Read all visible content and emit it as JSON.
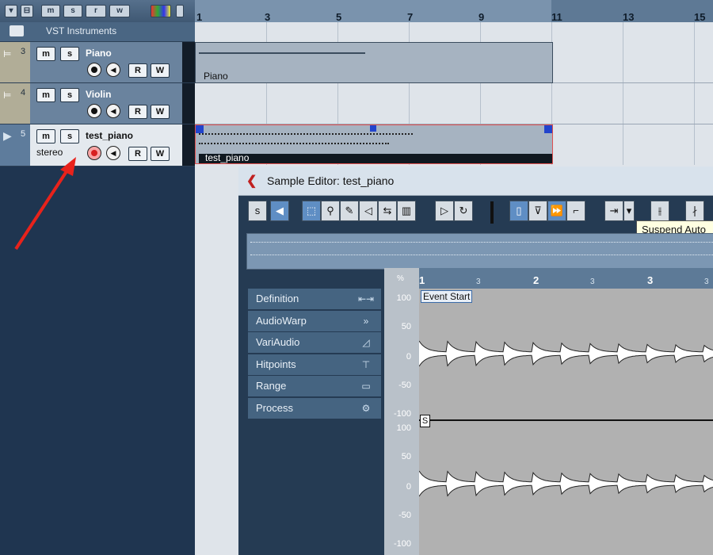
{
  "window": {
    "title": "Sample Editor: test_piano"
  },
  "topbar": {
    "buttons": [
      "m",
      "s",
      "r",
      "w"
    ]
  },
  "folder": {
    "label": "VST Instruments"
  },
  "tracks": [
    {
      "num": "3",
      "name": "Piano",
      "m": "m",
      "s": "s",
      "r": "R",
      "w": "W"
    },
    {
      "num": "4",
      "name": "Violin",
      "m": "m",
      "s": "s",
      "r": "R",
      "w": "W"
    },
    {
      "num": "5",
      "name": "test_piano",
      "sub": "stereo",
      "m": "m",
      "s": "s",
      "r": "R",
      "w": "W"
    }
  ],
  "ruler": {
    "ticks": [
      "1",
      "3",
      "5",
      "7",
      "9",
      "11",
      "13",
      "15"
    ]
  },
  "events": {
    "piano": "Piano",
    "test_piano": "test_piano"
  },
  "tooltip": {
    "text": "Suspend Auto"
  },
  "side_panel": [
    "Definition",
    "AudioWarp",
    "VariAudio",
    "Hitpoints",
    "Range",
    "Process"
  ],
  "scale": {
    "pct": "%",
    "labels": [
      "100",
      "50",
      "0",
      "-50",
      "-100",
      "100",
      "50",
      "0",
      "-50",
      "-100"
    ]
  },
  "wave_ruler": {
    "ticks": [
      "1",
      "2",
      "3"
    ],
    "subticks": [
      "3",
      "3",
      "3"
    ]
  },
  "markers": {
    "event_start": "Event Start",
    "s": "S"
  },
  "colors": {
    "accent": "#5f8ec4",
    "record": "#d82020",
    "arrow": "#e8221b"
  }
}
